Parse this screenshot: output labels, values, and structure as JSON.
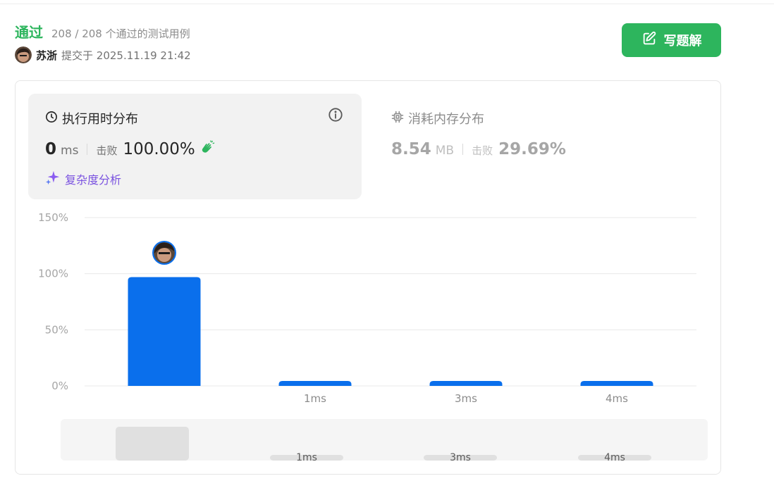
{
  "status": {
    "title": "通过",
    "tests_text": "208 / 208 个通过的测试用例"
  },
  "submission": {
    "user_name": "苏浙",
    "submitted_text": "提交于 2025.11.19 21:42"
  },
  "write_button": {
    "label": "写题解",
    "icon": "edit-icon"
  },
  "runtime": {
    "title": "执行用时分布",
    "icon": "clock-icon",
    "value": "0",
    "unit": "ms",
    "beat_label": "击败",
    "beat_value": "100.00%",
    "badge_icon": "clapping-hands-icon",
    "complexity_link": "复杂度分析"
  },
  "memory": {
    "title": "消耗内存分布",
    "icon": "chip-icon",
    "value": "8.54",
    "unit": "MB",
    "beat_label": "击败",
    "beat_value": "29.69%"
  },
  "colors": {
    "accent_green": "#2db55d",
    "bar_blue": "#0a6fec",
    "purple": "#7a52e0"
  },
  "chart_data": {
    "type": "bar",
    "categories": [
      "",
      "1ms",
      "3ms",
      "4ms"
    ],
    "values": [
      97,
      4,
      4,
      4
    ],
    "ylim": [
      0,
      150
    ],
    "yticks": [
      "0%",
      "50%",
      "100%",
      "150%"
    ],
    "grid": true,
    "user_marker_category": 0,
    "overview": {
      "categories": [
        "",
        "1ms",
        "3ms",
        "4ms"
      ],
      "values": [
        97,
        4,
        4,
        4
      ]
    }
  }
}
